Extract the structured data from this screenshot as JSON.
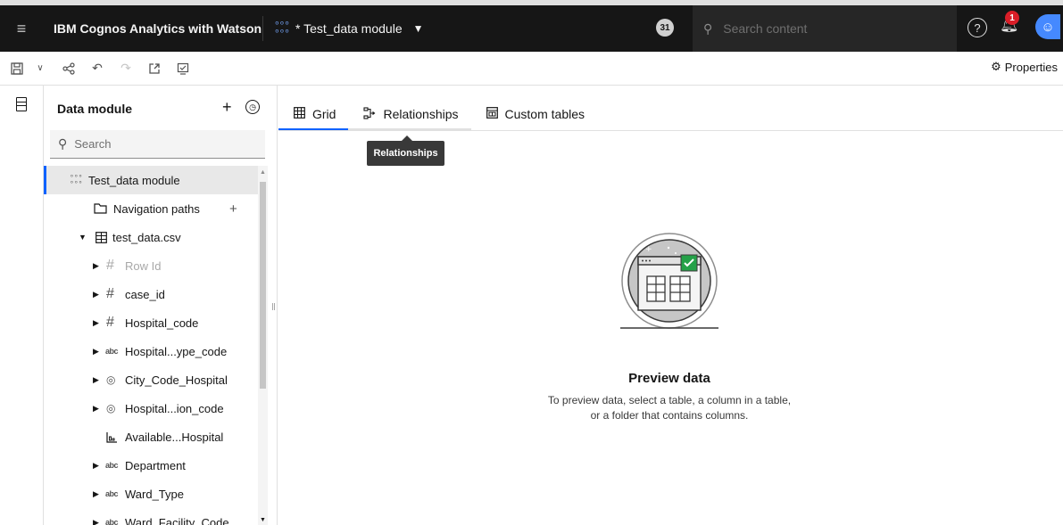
{
  "topbar": {
    "menu_icon": "hamburger-icon",
    "app_name": "IBM Cognos Analytics with Watson",
    "module_title": "* Test_data module",
    "count_badge": "31",
    "search_placeholder": "Search content",
    "notification_count": "1"
  },
  "toolbar": {
    "properties_label": "Properties"
  },
  "panel": {
    "title": "Data module",
    "search_placeholder": "Search",
    "tree": [
      {
        "label": "Test_data module",
        "icon": "module-icon",
        "selected": true
      },
      {
        "label": "Navigation paths",
        "icon": "folder-icon"
      },
      {
        "label": "test_data.csv",
        "icon": "table-icon",
        "expanded": true
      },
      {
        "label": "Row Id",
        "icon": "number-icon",
        "muted": true
      },
      {
        "label": "case_id",
        "icon": "number-icon"
      },
      {
        "label": "Hospital_code",
        "icon": "number-icon"
      },
      {
        "label": "Hospital...ype_code",
        "icon": "text-icon"
      },
      {
        "label": "City_Code_Hospital",
        "icon": "location-icon"
      },
      {
        "label": "Hospital...ion_code",
        "icon": "location-icon"
      },
      {
        "label": "Available...Hospital",
        "icon": "measure-icon"
      },
      {
        "label": "Department",
        "icon": "text-icon"
      },
      {
        "label": "Ward_Type",
        "icon": "text-icon"
      },
      {
        "label": "Ward_Facility_Code",
        "icon": "text-icon"
      }
    ]
  },
  "tabs": [
    {
      "label": "Grid",
      "active": true
    },
    {
      "label": "Relationships"
    },
    {
      "label": "Custom tables"
    }
  ],
  "tooltip": "Relationships",
  "empty_state": {
    "title": "Preview data",
    "description": "To preview data, select a table, a column in a table, or a folder that contains columns."
  },
  "colors": {
    "accent": "#0f62fe",
    "topbar_bg": "#161616",
    "illustration_teal": "#24a148"
  }
}
